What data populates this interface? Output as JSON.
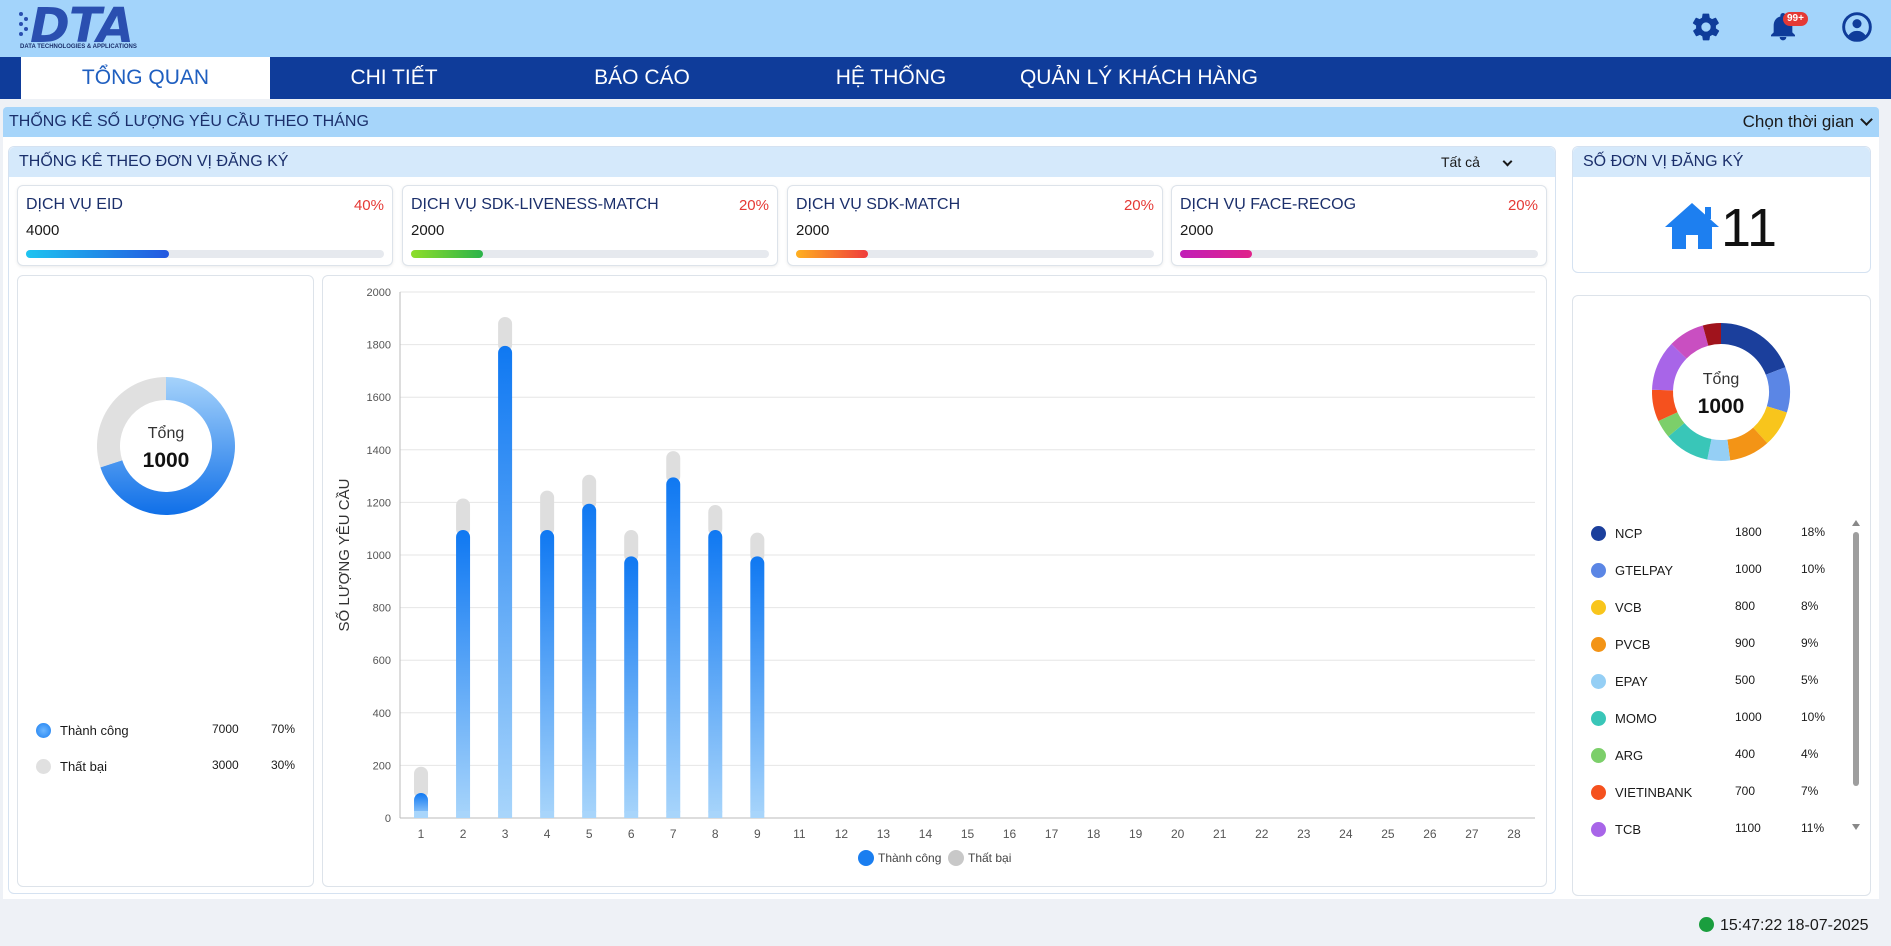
{
  "header": {
    "logo_text": "DTA",
    "logo_subtitle": "DATA TECHNOLOGIES & APPLICATIONS",
    "notification_badge": "99+",
    "icons": [
      "gear-icon",
      "bell-icon",
      "user-icon"
    ]
  },
  "nav": {
    "tabs": [
      {
        "label": "TỔNG QUAN",
        "active": true
      },
      {
        "label": "CHI TIẾT",
        "active": false
      },
      {
        "label": "BÁO CÁO",
        "active": false
      },
      {
        "label": "HỆ THỐNG",
        "active": false
      },
      {
        "label": "QUẢN LÝ KHÁCH HÀNG",
        "active": false
      }
    ]
  },
  "section": {
    "title": "THỐNG KÊ SỐ LƯỢNG YÊU CẦU THEO THÁNG",
    "time_select": "Chọn thời gian"
  },
  "unit_stats": {
    "title": "THỐNG KÊ THEO ĐƠN VỊ ĐĂNG KÝ",
    "filter": "Tất cả"
  },
  "services": [
    {
      "name": "DỊCH VỤ EID",
      "value": "4000",
      "percent": "40%",
      "fill": 0.4,
      "color_from": "#1ec4f0",
      "color_to": "#2357e0"
    },
    {
      "name": "DỊCH VỤ SDK-LIVENESS-MATCH",
      "value": "2000",
      "percent": "20%",
      "fill": 0.2,
      "color_from": "#8ede2a",
      "color_to": "#2bb34a"
    },
    {
      "name": "DỊCH VỤ SDK-MATCH",
      "value": "2000",
      "percent": "20%",
      "fill": 0.2,
      "color_from": "#ffb020",
      "color_to": "#ef3b3b"
    },
    {
      "name": "DỊCH VỤ FACE-RECOG",
      "value": "2000",
      "percent": "20%",
      "fill": 0.2,
      "color_from": "#c11fb8",
      "color_to": "#e0238a"
    }
  ],
  "status_donut": {
    "center_label": "Tổng",
    "center_value": "1000",
    "items": [
      {
        "label": "Thành công",
        "count": "7000",
        "percent": "70%",
        "fraction": 0.7,
        "color": "#1d7ff0"
      },
      {
        "label": "Thất bại",
        "count": "3000",
        "percent": "30%",
        "fraction": 0.3,
        "color": "#e0e0e0"
      }
    ]
  },
  "chart_data": {
    "type": "bar",
    "categories": [
      "1",
      "2",
      "3",
      "4",
      "5",
      "6",
      "7",
      "8",
      "9",
      "11",
      "12",
      "13",
      "14",
      "15",
      "16",
      "17",
      "18",
      "19",
      "20",
      "21",
      "22",
      "23",
      "24",
      "25",
      "26",
      "27",
      "28"
    ],
    "series": [
      {
        "name": "Thành công",
        "values": [
          95,
          1095,
          1795,
          1095,
          1195,
          995,
          1295,
          1095,
          995,
          0,
          0,
          0,
          0,
          0,
          0,
          0,
          0,
          0,
          0,
          0,
          0,
          0,
          0,
          0,
          0,
          0,
          0
        ]
      },
      {
        "name": "Thất bại",
        "values": [
          100,
          120,
          110,
          150,
          110,
          100,
          100,
          95,
          90,
          0,
          0,
          0,
          0,
          0,
          0,
          0,
          0,
          0,
          0,
          0,
          0,
          0,
          0,
          0,
          0,
          0,
          0
        ]
      }
    ],
    "stacked": true,
    "ylabel": "SỐ LƯỢNG YÊU CẦU",
    "xlabel": "",
    "ylim": [
      0,
      2000
    ],
    "yticks": [
      "0",
      "200",
      "400",
      "600",
      "800",
      "1000",
      "1200",
      "1400",
      "1600",
      "1800",
      "2000"
    ],
    "grid": true,
    "legend_position": "bottom",
    "colors": {
      "success": "#1a7ef0",
      "fail": "#dedede"
    }
  },
  "registered_units": {
    "title": "SỐ ĐƠN VỊ ĐĂNG KÝ",
    "count": "11",
    "center_label": "Tổng",
    "center_value": "1000",
    "items": [
      {
        "name": "NCP",
        "count": "1800",
        "percent": "18%",
        "color": "#1b3f9c"
      },
      {
        "name": "GTELPAY",
        "count": "1000",
        "percent": "10%",
        "color": "#5b86e5"
      },
      {
        "name": "VCB",
        "count": "800",
        "percent": "8%",
        "color": "#f8c51c"
      },
      {
        "name": "PVCB",
        "count": "900",
        "percent": "9%",
        "color": "#f39416"
      },
      {
        "name": "EPAY",
        "count": "500",
        "percent": "5%",
        "color": "#95cff5"
      },
      {
        "name": "MOMO",
        "count": "1000",
        "percent": "10%",
        "color": "#39c6b8"
      },
      {
        "name": "ARG",
        "count": "400",
        "percent": "4%",
        "color": "#7ccf6a"
      },
      {
        "name": "VIETINBANK",
        "count": "700",
        "percent": "7%",
        "color": "#f5511e"
      },
      {
        "name": "TCB",
        "count": "1100",
        "percent": "11%",
        "color": "#a865e8"
      }
    ],
    "extra_segments": [
      {
        "fraction": 0.08,
        "color": "#c94fc1"
      },
      {
        "fraction": 0.04,
        "color": "#a0131c"
      }
    ]
  },
  "footer": {
    "datetime": "15:47:22 18-07-2025"
  }
}
